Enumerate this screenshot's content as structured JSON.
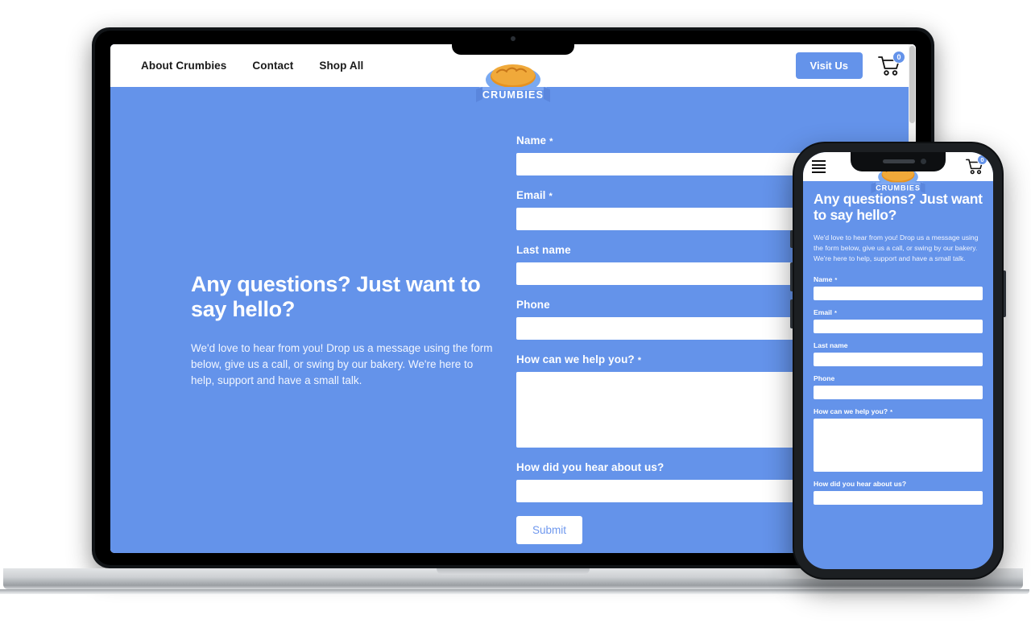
{
  "brand": {
    "name": "CRUMBIES",
    "logo_icon": "bread-loaf-logo"
  },
  "colors": {
    "brand_blue": "#6493ea",
    "page_background": "#6493ea",
    "button_text_blue": "#6f98ee",
    "white": "#ffffff"
  },
  "desktop": {
    "nav": {
      "links": [
        {
          "label": "About Crumbies"
        },
        {
          "label": "Contact"
        },
        {
          "label": "Shop All"
        }
      ],
      "visit_button": "Visit Us",
      "cart_icon": "shopping-cart-icon",
      "cart_count": "0"
    },
    "hero": {
      "heading": "Any questions? Just want to say hello?",
      "paragraph": " We'd love to hear from you! Drop us a message using the form below, give us a call, or swing by our bakery. We're here to help, support and have a small talk."
    },
    "form": {
      "fields": [
        {
          "label": "Name",
          "required": "*",
          "type": "input",
          "value": ""
        },
        {
          "label": "Email",
          "required": "*",
          "type": "input",
          "value": ""
        },
        {
          "label": "Last name",
          "required": "",
          "type": "input",
          "value": ""
        },
        {
          "label": "Phone",
          "required": "",
          "type": "input",
          "value": ""
        },
        {
          "label": "How can we help you?",
          "required": "*",
          "type": "textarea",
          "value": ""
        },
        {
          "label": "How did you hear about us?",
          "required": "",
          "type": "input",
          "value": ""
        }
      ],
      "submit_label": "Submit"
    }
  },
  "mobile": {
    "nav": {
      "menu_icon": "hamburger-menu-icon",
      "cart_icon": "shopping-cart-icon",
      "cart_count": "0"
    },
    "hero": {
      "heading": "Any questions? Just want to say hello?",
      "paragraph": " We'd love to hear from you! Drop us a message using the form below, give us a call, or swing by our bakery. We're here to help, support and have a small talk."
    },
    "form": {
      "fields": [
        {
          "label": "Name",
          "required": "*",
          "type": "input",
          "value": ""
        },
        {
          "label": "Email",
          "required": "*",
          "type": "input",
          "value": ""
        },
        {
          "label": "Last name",
          "required": "",
          "type": "input",
          "value": ""
        },
        {
          "label": "Phone",
          "required": "",
          "type": "input",
          "value": ""
        },
        {
          "label": "How can we help you?",
          "required": "*",
          "type": "textarea",
          "value": ""
        },
        {
          "label": "How did you hear about us?",
          "required": "",
          "type": "input",
          "value": ""
        }
      ]
    }
  }
}
